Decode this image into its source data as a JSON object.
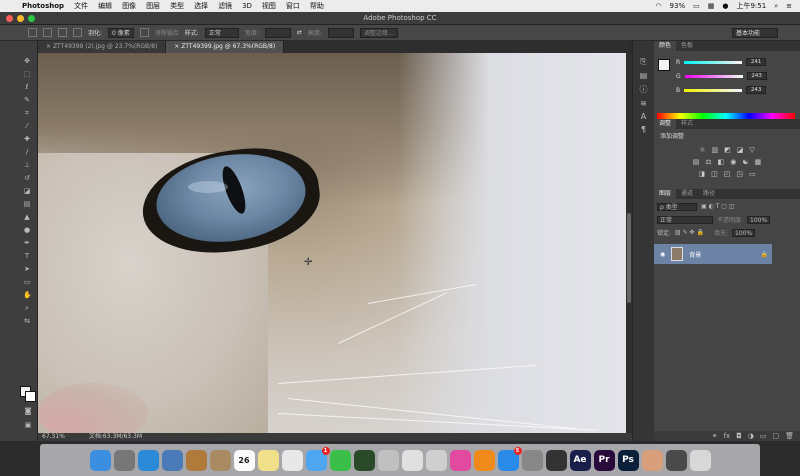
{
  "menubar": {
    "app_name": "Photoshop",
    "items": [
      "文件",
      "编辑",
      "图像",
      "图层",
      "类型",
      "选择",
      "滤镜",
      "3D",
      "视图",
      "窗口",
      "帮助"
    ],
    "battery": "93%",
    "clock": "上午9:51"
  },
  "window": {
    "title": "Adobe Photoshop CC"
  },
  "options_bar": {
    "feather_label": "羽化:",
    "feather_value": "0 像素",
    "antialias_label": "消除锯齿",
    "style_label": "样式:",
    "style_value": "正常",
    "width_label": "宽度:",
    "height_label": "高度:",
    "refine_button": "调整边缘...",
    "workspace": "基本功能"
  },
  "doc_tabs": [
    {
      "label": "ZTT49399 (2).jpg @ 23.7%(RGB/8)",
      "active": false
    },
    {
      "label": "ZTT49399.jpg @ 67.3%(RGB/8)",
      "active": true
    }
  ],
  "status": {
    "zoom": "67.31%",
    "doc_size": "文档:63.3M/63.3M"
  },
  "color_panel": {
    "tabs": [
      "颜色",
      "色板"
    ],
    "r": {
      "label": "R",
      "value": "241"
    },
    "g": {
      "label": "G",
      "value": "243"
    },
    "b": {
      "label": "B",
      "value": "243"
    },
    "fg_color": "#f1f3f3"
  },
  "adjust_panel": {
    "tabs": [
      "调整",
      "样式"
    ],
    "heading": "添加调整"
  },
  "layers_panel": {
    "tabs": [
      "图层",
      "通道",
      "路径"
    ],
    "kind_label": "ρ 类型",
    "blend_mode": "正常",
    "opacity_label": "不透明度:",
    "opacity_value": "100%",
    "lock_label": "锁定:",
    "fill_label": "填充:",
    "fill_value": "100%",
    "layer_name": "背景"
  },
  "dock": {
    "apps": [
      {
        "icon": "finder-icon",
        "color": "#3b8fe0",
        "text": ""
      },
      {
        "icon": "launchpad-icon",
        "color": "#777",
        "text": ""
      },
      {
        "icon": "safari-icon",
        "color": "#2a8ad8",
        "text": ""
      },
      {
        "icon": "preview-icon",
        "color": "#4a7ab8",
        "text": ""
      },
      {
        "icon": "notes-icon",
        "color": "#b07a3a",
        "text": ""
      },
      {
        "icon": "contacts-icon",
        "color": "#a98a62",
        "text": ""
      },
      {
        "icon": "calendar-icon",
        "color": "#fafafa",
        "text": "26"
      },
      {
        "icon": "stickies-icon",
        "color": "#f1e08a",
        "text": ""
      },
      {
        "icon": "photos-icon",
        "color": "#e8e8e8",
        "text": ""
      },
      {
        "icon": "messages-icon",
        "color": "#4fa6f0",
        "text": ""
      },
      {
        "icon": "facetime-icon",
        "color": "#3bbf4a",
        "text": ""
      },
      {
        "icon": "photo-booth-icon",
        "color": "#2a4a2a",
        "text": ""
      },
      {
        "icon": "image-capture-icon",
        "color": "#c0c0c0",
        "text": ""
      },
      {
        "icon": "numbers-icon",
        "color": "#e0e0e0",
        "text": ""
      },
      {
        "icon": "keynote-icon",
        "color": "#cfcfcf",
        "text": ""
      },
      {
        "icon": "itunes-icon",
        "color": "#e24aa0",
        "text": ""
      },
      {
        "icon": "ibooks-icon",
        "color": "#f08a1a",
        "text": ""
      },
      {
        "icon": "app-store-icon",
        "color": "#2a8ae8",
        "text": ""
      },
      {
        "icon": "system-preferences-icon",
        "color": "#888",
        "text": ""
      },
      {
        "icon": "quicktime-icon",
        "color": "#333",
        "text": ""
      },
      {
        "icon": "after-effects-icon",
        "color": "#1a1f4a",
        "text": "Ae"
      },
      {
        "icon": "premiere-icon",
        "color": "#2a0a3a",
        "text": "Pr"
      },
      {
        "icon": "photoshop-icon",
        "color": "#0a1f3a",
        "text": "Ps"
      },
      {
        "icon": "avatar-icon",
        "color": "#d8a07a",
        "text": ""
      },
      {
        "icon": "downloads-icon",
        "color": "#4a4a4a",
        "text": ""
      },
      {
        "icon": "trash-icon",
        "color": "#d8d8d8",
        "text": ""
      }
    ],
    "badges": {
      "messages": "1",
      "app_store": "5"
    }
  }
}
